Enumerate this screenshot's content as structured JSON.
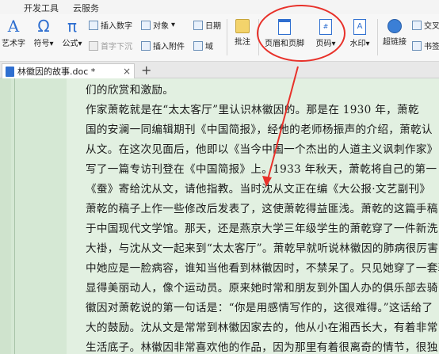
{
  "menu": {
    "items": [
      "开发工具",
      "云服务"
    ]
  },
  "ribbon": {
    "wordart_label": "艺术字",
    "symbol_label": "符号",
    "formula_label": "公式",
    "insert_number_label": "插入数字",
    "object_label": "对象",
    "date_label": "日期",
    "dropcap_label": "首字下沉",
    "attachment_label": "插入附件",
    "field_label": "域",
    "comment_label": "批注",
    "header_footer_label": "页眉和页脚",
    "page_number_label": "页码",
    "watermark_label": "水印",
    "hyperlink_label": "超链接",
    "crossref_label": "交叉",
    "bookmark_label": "书签"
  },
  "tab": {
    "title": "林徽因的故事.doc *",
    "close": "×",
    "new": "+"
  },
  "document": {
    "lines": [
      "们的欣赏和激励。",
      "    作家萧乾就是在“太太客厅”里认识林徽因的。那是在 1930 年，萧乾",
      "国的安澜一同编辑期刊《中国简报》，经他的老师杨振声的介绍，萧乾认",
      "从文。在这次见面后，他即以《当今中国一个杰出的人道主义讽刺作家》",
      "写了一篇专访刊登在《中国简报》上。1933 年秋天，萧乾将自己的第一",
      "《蚕》寄给沈从文，请他指教。当时沈从文正在编《大公报·文艺副刊》",
      "萧乾的稿子上作一些修改后发表了，这使萧乾得益匪浅。萧乾的这篇手稿",
      "于中国现代文学馆。那天，还是燕京大学三年级学生的萧乾穿了一件新洗",
      "大褂，与沈从文一起来到“太太客厅”。萧乾早就听说林徽因的肺病很厉害",
      "中她应是一脸病容，谁知当他看到林徽因时，不禁呆了。只见她穿了一套骑",
      "显得美丽动人，像个运动员。原来她时常和朋友到外国人办的俱乐部去骑",
      "徽因对萧乾说的第一句话是：“你是用感情写作的，这很难得。”这话给了",
      "大的鼓励。沈从文是常常到林徽因家去的，他从小在湘西长大，有着非常",
      "生活底子。林徽因非常喜欢他的作品，因为那里有着很离奇的情节，很独"
    ]
  },
  "colors": {
    "annotation_red": "#e8312a",
    "eye_protection_green": "#e2f0e1"
  }
}
